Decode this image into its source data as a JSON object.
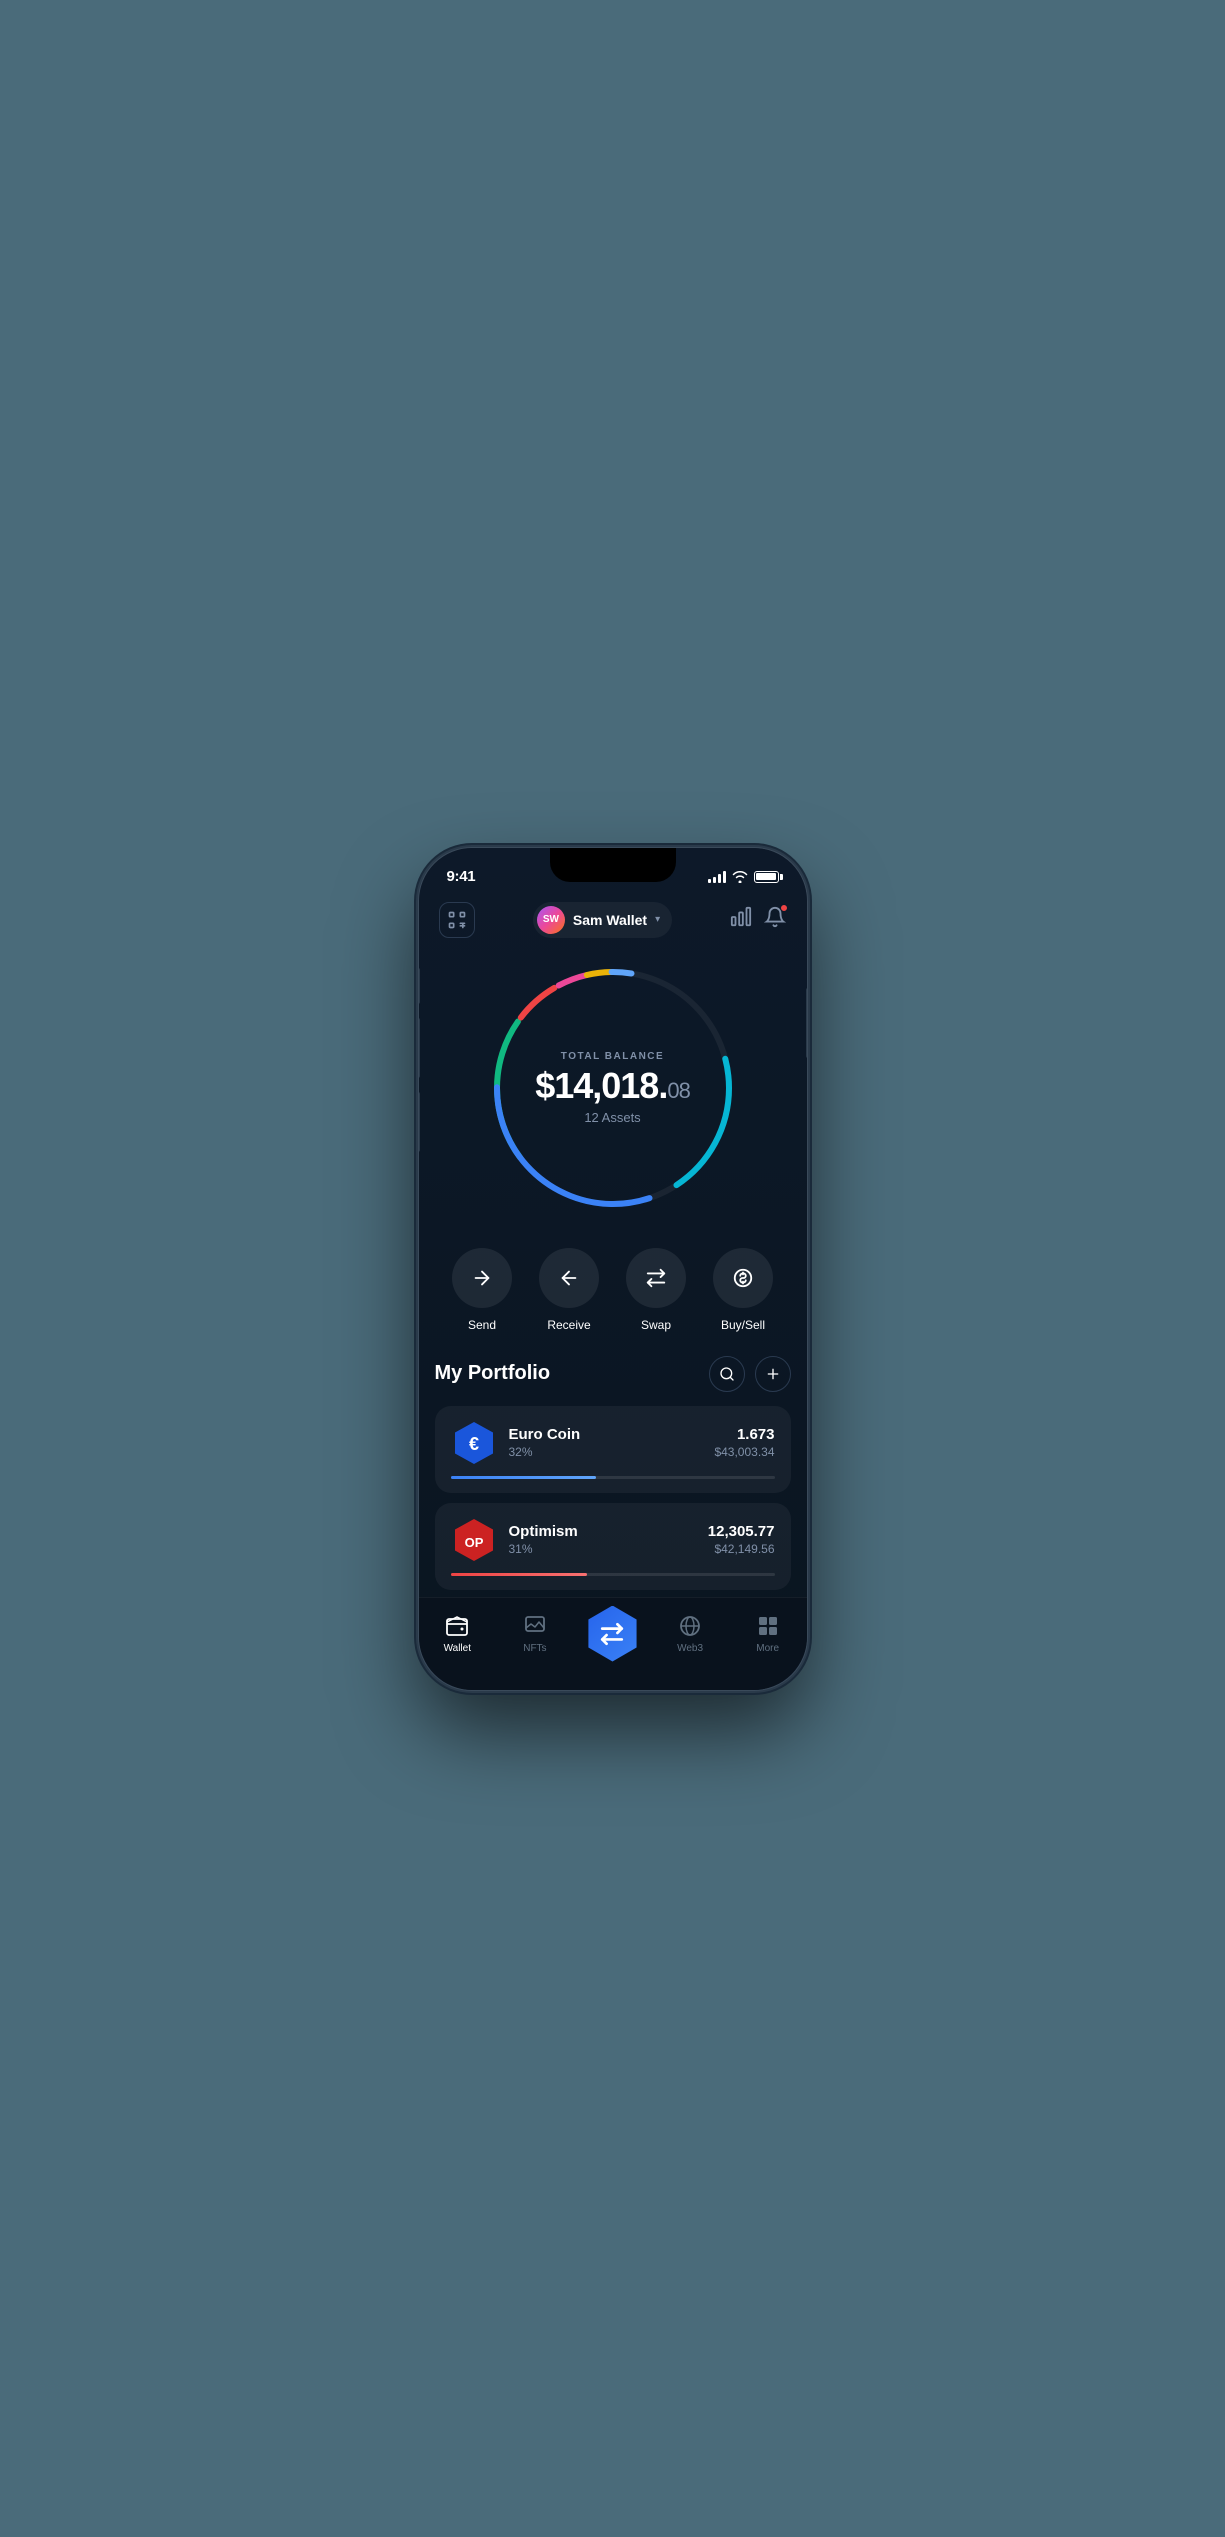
{
  "statusBar": {
    "time": "9:41",
    "signalBars": 4,
    "battery": 100
  },
  "header": {
    "scanLabel": "scan",
    "avatarInitials": "SW",
    "walletName": "Sam Wallet",
    "chevronLabel": "▾",
    "chartLabel": "chart",
    "bellLabel": "bell"
  },
  "balance": {
    "label": "TOTAL BALANCE",
    "mainAmount": "$14,018.",
    "decimalAmount": "08",
    "assetsCount": "12 Assets"
  },
  "actions": [
    {
      "id": "send",
      "label": "Send",
      "icon": "send"
    },
    {
      "id": "receive",
      "label": "Receive",
      "icon": "receive"
    },
    {
      "id": "swap",
      "label": "Swap",
      "icon": "swap"
    },
    {
      "id": "buysell",
      "label": "Buy/Sell",
      "icon": "buysell"
    }
  ],
  "portfolio": {
    "title": "My Portfolio",
    "searchLabel": "search",
    "addLabel": "add",
    "assets": [
      {
        "id": "euro-coin",
        "name": "Euro Coin",
        "percent": "32%",
        "amount": "1.673",
        "value": "$43,003.34",
        "barWidth": "45",
        "iconText": "€",
        "iconType": "euro"
      },
      {
        "id": "optimism",
        "name": "Optimism",
        "percent": "31%",
        "amount": "12,305.77",
        "value": "$42,149.56",
        "barWidth": "42",
        "iconText": "OP",
        "iconType": "op"
      }
    ]
  },
  "bottomNav": [
    {
      "id": "wallet",
      "label": "Wallet",
      "icon": "wallet",
      "active": true
    },
    {
      "id": "nfts",
      "label": "NFTs",
      "icon": "nfts",
      "active": false
    },
    {
      "id": "swap-center",
      "label": "",
      "icon": "swap-center",
      "active": false,
      "isCenter": true
    },
    {
      "id": "web3",
      "label": "Web3",
      "icon": "web3",
      "active": false
    },
    {
      "id": "more",
      "label": "More",
      "icon": "more",
      "active": false
    }
  ]
}
